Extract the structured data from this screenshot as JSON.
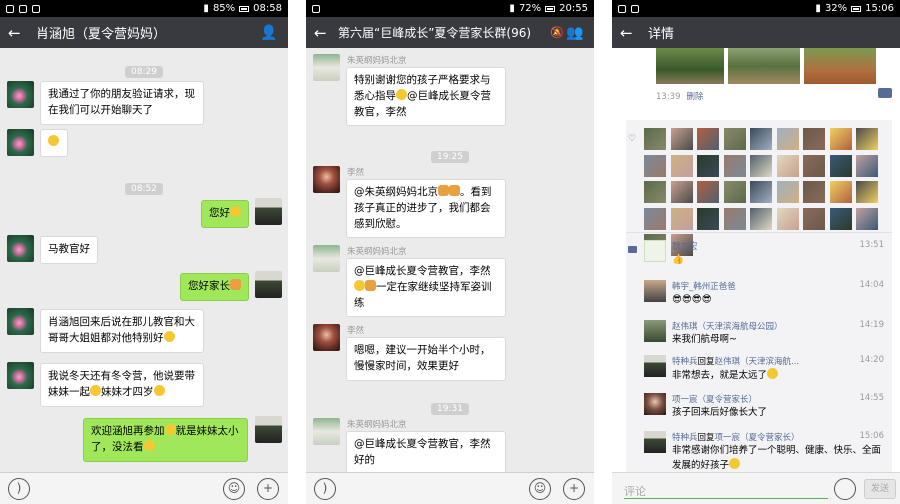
{
  "panel1": {
    "status": {
      "time": "08:58",
      "battery": "85%"
    },
    "title": "肖涵旭（夏令营妈妈）",
    "messages": {
      "t1": "08:29",
      "m1": "我通过了你的朋友验证请求，现在我们可以开始聊天了",
      "t2": "08:52",
      "m2": "您好",
      "m3": "马教官好",
      "m4": "您好家长",
      "m5": "肖涵旭回来后说在那儿教官和大哥哥大姐姐都对他特别好",
      "m6": "我说冬天还有冬令营，他说要带妹妹一起",
      "m6b": "妹妹才四岁",
      "m7": "欢迎涵旭再参加",
      "m7b": "就是妹妹太小了，没法看"
    }
  },
  "panel2": {
    "status": {
      "time": "20:55",
      "battery": "72%"
    },
    "title": "第六届“巨峰成长”夏令营家长群(96)",
    "messages": {
      "n1": "朱英纲妈妈北京",
      "m1": "特别谢谢您的孩子严格要求与悉心指导",
      "m1b": "@巨峰成长夏令营教官，李然",
      "t1": "19:25",
      "n2": "李然",
      "m2": "@朱英纲妈妈北京",
      "m2b": "。看到孩子真正的进步了，我们都会感到欣慰。",
      "n3": "朱英纲妈妈北京",
      "m3": "@巨峰成长夏令营教官，李然",
      "m3b": "一定在家继续坚持军姿训练",
      "n4": "李然",
      "m4": "嗯嗯，建议一开始半个小时，慢慢家时间，效果更好",
      "t2": "19:31",
      "n5": "朱英纲妈妈北京",
      "m5": "@巨峰成长夏令营教官，李然 好的"
    }
  },
  "panel3": {
    "status": {
      "time": "15:06",
      "battery": "32%"
    },
    "title": "详情",
    "post_time": "13:39",
    "delete_label": "删除",
    "comments": [
      {
        "name": "魏方宏",
        "time": "13:51",
        "text": "👍"
      },
      {
        "name": "韩宇_韩州正爸爸",
        "time": "14:04",
        "text": "😎😎😎😎"
      },
      {
        "name": "赵伟琪（天津滨海航母公园）",
        "time": "14:19",
        "text": "来我们航母啊~"
      },
      {
        "name": "特种兵",
        "reply": "回复",
        "target": "赵伟琪（天津滨海航...",
        "time": "14:20",
        "text": "非常想去，就是太远了"
      },
      {
        "name": "项一宸（夏令营家长）",
        "time": "14:55",
        "text": "孩子回来后好像长大了"
      },
      {
        "name": "特种兵",
        "reply": "回复",
        "target": "项一宸（夏令营家长）",
        "time": "15:06",
        "text": "非常感谢你们培养了一个聪明、健康、快乐、全面发展的好孩子"
      }
    ],
    "input_placeholder": "评论",
    "send_label": "发送"
  }
}
